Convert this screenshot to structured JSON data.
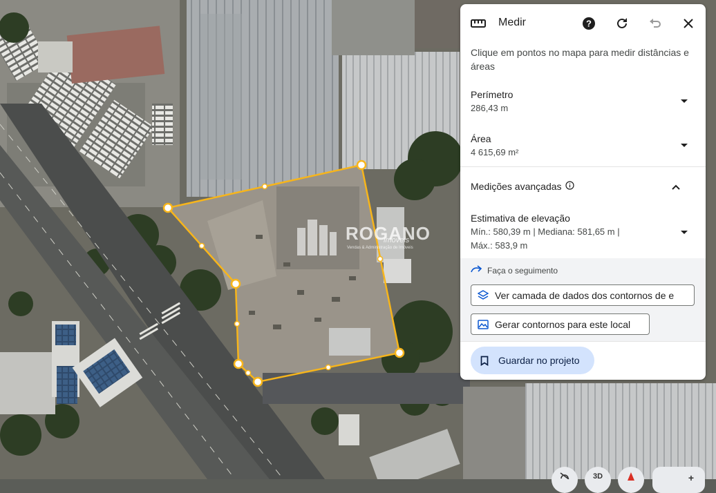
{
  "header": {
    "title": "Medir",
    "icons": [
      "ruler-icon",
      "help-icon",
      "refresh-icon",
      "undo-icon",
      "close-icon"
    ]
  },
  "description": "Clique em pontos no mapa para medir distâncias e áreas",
  "perimeter": {
    "label": "Perímetro",
    "value": "286,43 m"
  },
  "area": {
    "label": "Área",
    "value": "4 615,69 m²"
  },
  "advanced": {
    "label": "Medições avançadas"
  },
  "elevation": {
    "label": "Estimativa de elevação",
    "line1": "Mín.: 580,39 m | Mediana: 581,65 m |",
    "line2": "Máx.: 583,9 m"
  },
  "follow": {
    "label": "Faça o seguimento"
  },
  "buttons": {
    "contours_layer": "Ver camada de dados dos contornos de e",
    "generate_contours": "Gerar contornos para este local",
    "save_project": "Guardar no projeto"
  },
  "map_controls": {
    "view_3d": "3D"
  },
  "watermark": {
    "brand": "ROGANO",
    "sub": "imoveis",
    "tagline": "Vendas & Administração de Imóveis"
  },
  "colors": {
    "measure_line": "#f7b51b",
    "accent": "#0b57d0",
    "save_bg": "#d3e3fd"
  }
}
